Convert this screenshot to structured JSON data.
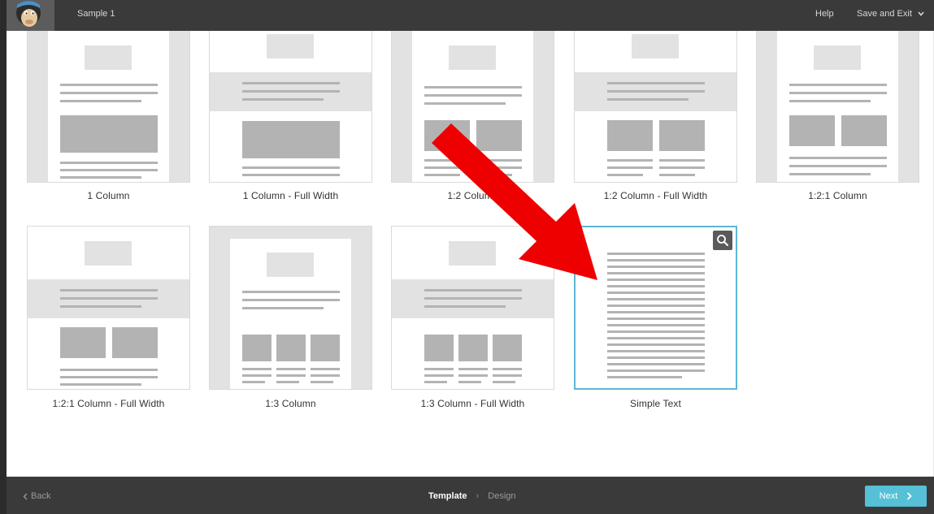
{
  "app": {
    "campaign_title": "Sample 1"
  },
  "header": {
    "help_label": "Help",
    "save_exit_label": "Save and Exit"
  },
  "templates": [
    {
      "label": "1 Column"
    },
    {
      "label": "1 Column - Full Width"
    },
    {
      "label": "1:2 Column"
    },
    {
      "label": "1:2 Column - Full Width"
    },
    {
      "label": "1:2:1 Column"
    },
    {
      "label": "1:2:1 Column - Full Width"
    },
    {
      "label": "1:3 Column"
    },
    {
      "label": "1:3 Column - Full Width"
    },
    {
      "label": "Simple Text",
      "selected": true
    }
  ],
  "footer": {
    "back_label": "Back",
    "steps": [
      {
        "label": "Template",
        "active": true
      },
      {
        "label": "Design",
        "active": false
      }
    ],
    "next_label": "Next"
  },
  "colors": {
    "accent": "#55c0d6",
    "selected_border": "#5fb6d6",
    "annotation_arrow": "#ee0000"
  }
}
